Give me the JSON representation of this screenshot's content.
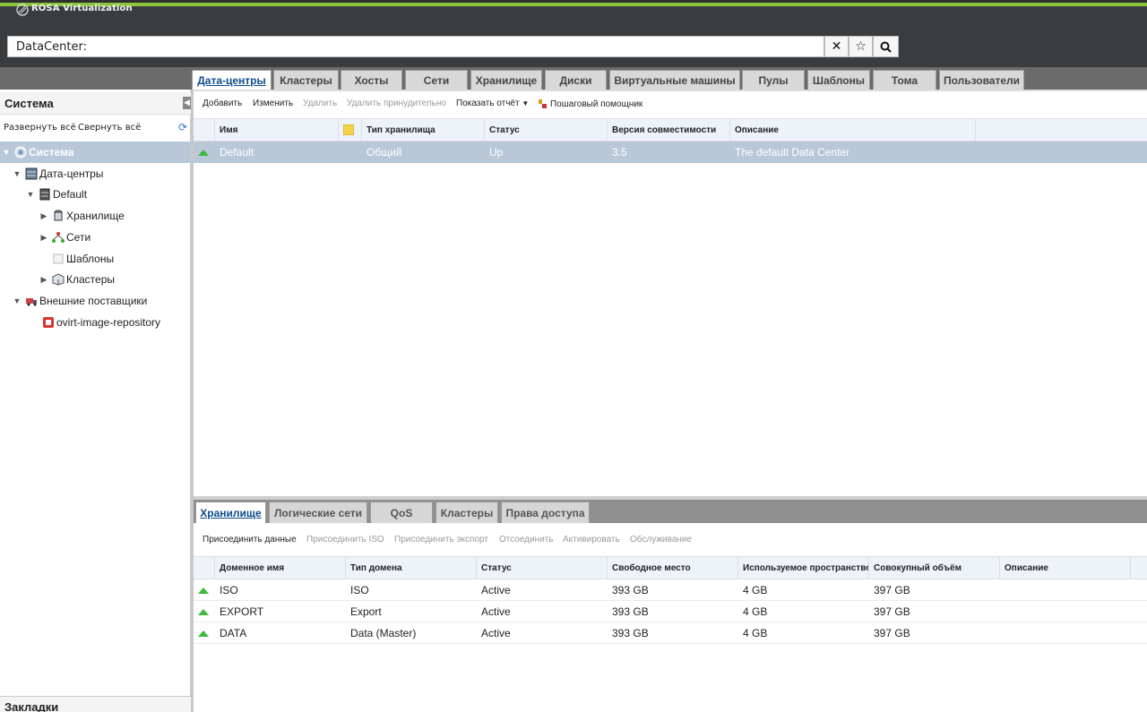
{
  "app": {
    "title": "ROSA Virtualization"
  },
  "search": {
    "value": "DataCenter:"
  },
  "main_tabs": [
    {
      "label": "Дата-центры"
    },
    {
      "label": "Кластеры"
    },
    {
      "label": "Хосты"
    },
    {
      "label": "Сети"
    },
    {
      "label": "Хранилище"
    },
    {
      "label": "Диски"
    },
    {
      "label": "Виртуальные машины"
    },
    {
      "label": "Пулы"
    },
    {
      "label": "Шаблоны"
    },
    {
      "label": "Тома"
    },
    {
      "label": "Пользователи"
    }
  ],
  "left": {
    "title": "Система",
    "expand_all": "Развернуть всё",
    "collapse_all": "Свернуть всё",
    "tree": [
      {
        "label": "Система"
      },
      {
        "label": "Дата-центры"
      },
      {
        "label": "Default"
      },
      {
        "label": "Хранилище"
      },
      {
        "label": "Сети"
      },
      {
        "label": "Шаблоны"
      },
      {
        "label": "Кластеры"
      },
      {
        "label": "Внешние поставщики"
      },
      {
        "label": "ovirt-image-repository"
      }
    ],
    "bookmarks": "Закладки"
  },
  "toolbar": {
    "add": "Добавить",
    "edit": "Изменить",
    "remove": "Удалить",
    "force_remove": "Удалить принудительно",
    "report": "Показать отчёт",
    "guide": "Пошаговый помощник"
  },
  "grid": {
    "columns": [
      "Имя",
      "Тип хранилища",
      "Статус",
      "Версия совместимости",
      "Описание"
    ],
    "rows": [
      {
        "name": "Default",
        "type": "Общий",
        "status": "Up",
        "version": "3.5",
        "description": "The default Data Center"
      }
    ]
  },
  "sub_tabs": [
    {
      "label": "Хранилище"
    },
    {
      "label": "Логические сети"
    },
    {
      "label": "QoS"
    },
    {
      "label": "Кластеры"
    },
    {
      "label": "Права доступа"
    }
  ],
  "sub_toolbar": {
    "attach_data": "Присоединить данные",
    "attach_iso": "Присоединить ISO",
    "attach_export": "Присоединить экспорт",
    "detach": "Отсоединить",
    "activate": "Активировать",
    "maintenance": "Обслуживание"
  },
  "sub_grid": {
    "columns": [
      "Доменное имя",
      "Тип домена",
      "Статус",
      "Свободное место",
      "Используемое пространство",
      "Совокупный объём",
      "Описание"
    ],
    "rows": [
      {
        "name": "ISO",
        "type": "ISO",
        "status": "Active",
        "free": "393 GB",
        "used": "4 GB",
        "total": "397 GB"
      },
      {
        "name": "EXPORT",
        "type": "Export",
        "status": "Active",
        "free": "393 GB",
        "used": "4 GB",
        "total": "397 GB"
      },
      {
        "name": "DATA",
        "type": "Data (Master)",
        "status": "Active",
        "free": "393 GB",
        "used": "4 GB",
        "total": "397 GB"
      }
    ]
  },
  "colors": {
    "accent": "#8cc63f",
    "header_bg": "#3a3d40",
    "selection": "#b8c8d8",
    "active_tab_text": "#0b4c8c"
  }
}
